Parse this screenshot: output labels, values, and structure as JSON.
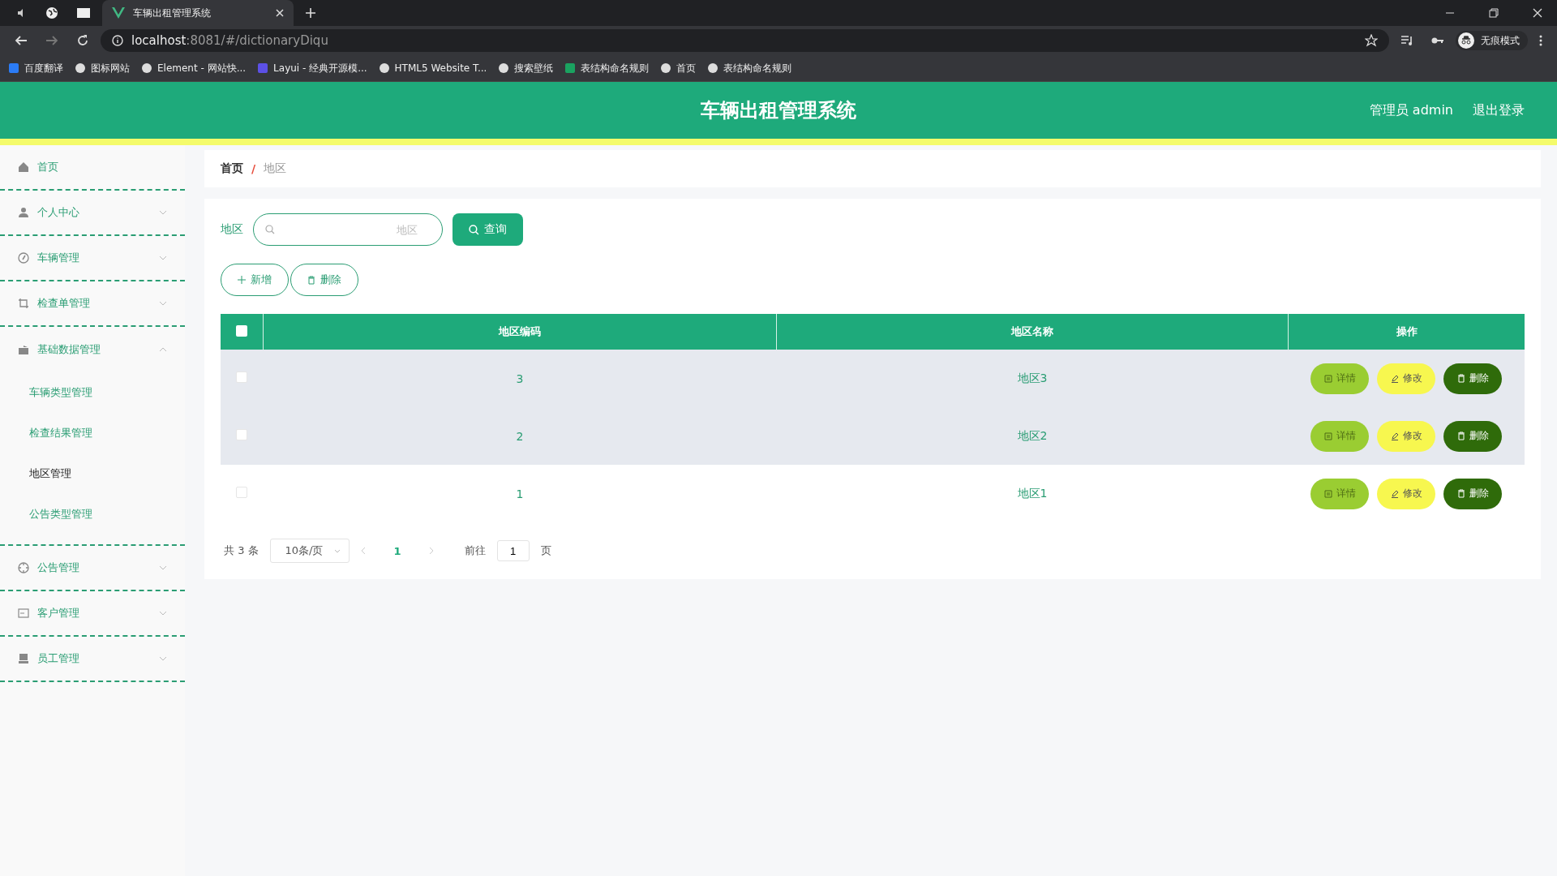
{
  "browser": {
    "tab_title": "车辆出租管理系统",
    "url_host": "localhost",
    "url_path": ":8081/#/dictionaryDiqu",
    "profile": "无痕模式",
    "bookmarks": [
      "百度翻译",
      "图标网站",
      "Element - 网站快...",
      "Layui - 经典开源模...",
      "HTML5 Website T...",
      "搜索壁纸",
      "表结构命名规则",
      "首页",
      "表结构命名规则"
    ]
  },
  "header": {
    "title": "车辆出租管理系统",
    "user": "管理员 admin",
    "logout": "退出登录"
  },
  "sidebar": {
    "items": [
      {
        "label": "首页",
        "expandable": false
      },
      {
        "label": "个人中心",
        "expandable": true,
        "expanded": false
      },
      {
        "label": "车辆管理",
        "expandable": true,
        "expanded": false
      },
      {
        "label": "检查单管理",
        "expandable": true,
        "expanded": false
      },
      {
        "label": "基础数据管理",
        "expandable": true,
        "expanded": true,
        "children": [
          {
            "label": "车辆类型管理",
            "selected": false
          },
          {
            "label": "检查结果管理",
            "selected": false
          },
          {
            "label": "地区管理",
            "selected": true
          },
          {
            "label": "公告类型管理",
            "selected": false
          }
        ]
      },
      {
        "label": "公告管理",
        "expandable": true,
        "expanded": false
      },
      {
        "label": "客户管理",
        "expandable": true,
        "expanded": false
      },
      {
        "label": "员工管理",
        "expandable": true,
        "expanded": false
      }
    ]
  },
  "breadcrumb": {
    "items": [
      "首页",
      "地区"
    ],
    "separator": "/"
  },
  "search": {
    "label": "地区",
    "placeholder": "地区",
    "button": "查询"
  },
  "actions": [
    "新增",
    "删除"
  ],
  "table": {
    "select_all_checked": false,
    "columns": [
      "地区编码",
      "地区名称",
      "操作"
    ],
    "rows": [
      {
        "checked": false,
        "shaded": true,
        "code": "3",
        "name": "地区3",
        "buttons": [
          {
            "kind": "detail",
            "label": "详情"
          },
          {
            "kind": "edit",
            "label": "修改"
          },
          {
            "kind": "delete",
            "label": "删除"
          }
        ]
      },
      {
        "checked": false,
        "shaded": true,
        "code": "2",
        "name": "地区2",
        "buttons": [
          {
            "kind": "detail",
            "label": "详情"
          },
          {
            "kind": "edit",
            "label": "修改"
          },
          {
            "kind": "delete",
            "label": "删除"
          }
        ]
      },
      {
        "checked": false,
        "shaded": false,
        "code": "1",
        "name": "地区1",
        "buttons": [
          {
            "kind": "detail",
            "label": "详情"
          },
          {
            "kind": "edit",
            "label": "修改"
          },
          {
            "kind": "delete",
            "label": "删除"
          }
        ]
      }
    ]
  },
  "pagination": {
    "total": "共 3 条",
    "page_size": "10条/页",
    "current": "1",
    "goto_label": "前往",
    "goto_value": "1",
    "page_suffix": "页"
  }
}
